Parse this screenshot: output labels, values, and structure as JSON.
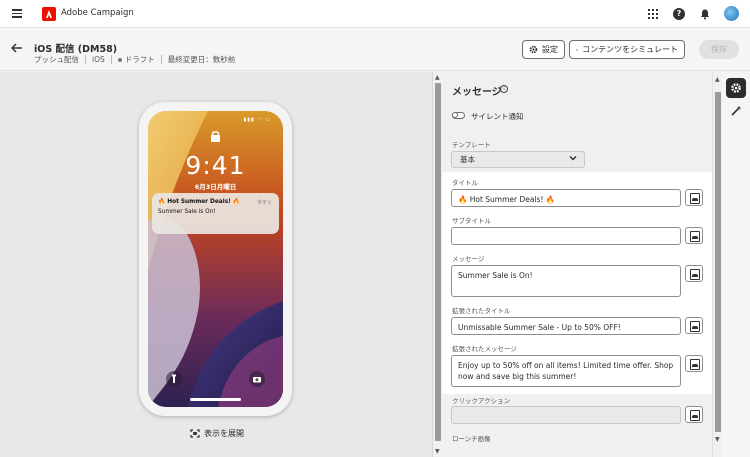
{
  "app": {
    "name": "Adobe Campaign"
  },
  "header": {
    "title": "iOS 配信 (DM58)",
    "meta": {
      "type": "プッシュ配信",
      "channel": "iOS",
      "status": "ドラフト",
      "modified": "最終変更日：数秒前"
    },
    "buttons": {
      "settings": "設定",
      "simulate": "コンテンツをシミュレート",
      "save": "保存"
    }
  },
  "preview": {
    "time": "9:41",
    "date": "6月3日月曜日",
    "notification": {
      "title": "🔥 Hot Summer Deals! 🔥",
      "time": "今すぐ",
      "body": "Summer Sale is On!"
    },
    "expand_label": "表示を展開"
  },
  "panel": {
    "section_title": "メッセージ",
    "silent_label": "サイレント通知",
    "silent_enabled": false,
    "template_label": "テンプレート",
    "template_value": "基本",
    "fields": {
      "title_label": "タイトル",
      "title_value": "🔥 Hot Summer Deals! 🔥",
      "subtitle_label": "サブタイトル",
      "subtitle_value": "",
      "message_label": "メッセージ",
      "message_value": "Summer Sale is On!",
      "ext_title_label": "拡張されたタイトル",
      "ext_title_value": "Unmissable Summer Sale - Up to 50% OFF!",
      "ext_message_label": "拡張されたメッセージ",
      "ext_message_value": "Enjoy up to 50% off on all items! Limited time offer. Shop now and save big this summer!",
      "click_action_label": "クリックアクション",
      "click_action_value": "",
      "launch_image_label": "ローンチ画像"
    }
  },
  "colors": {
    "brand": "#eb1000",
    "rail_active": "#2c2c2c"
  },
  "icons": [
    "menu-icon",
    "adobe-logo-icon",
    "apps-grid-icon",
    "help-icon",
    "bell-icon",
    "back-arrow-icon",
    "gear-icon",
    "simulate-icon",
    "lock-icon",
    "flashlight-icon",
    "camera-icon",
    "expand-icon",
    "info-icon",
    "personalization-icon",
    "settings-gear-icon",
    "magic-wand-icon"
  ]
}
